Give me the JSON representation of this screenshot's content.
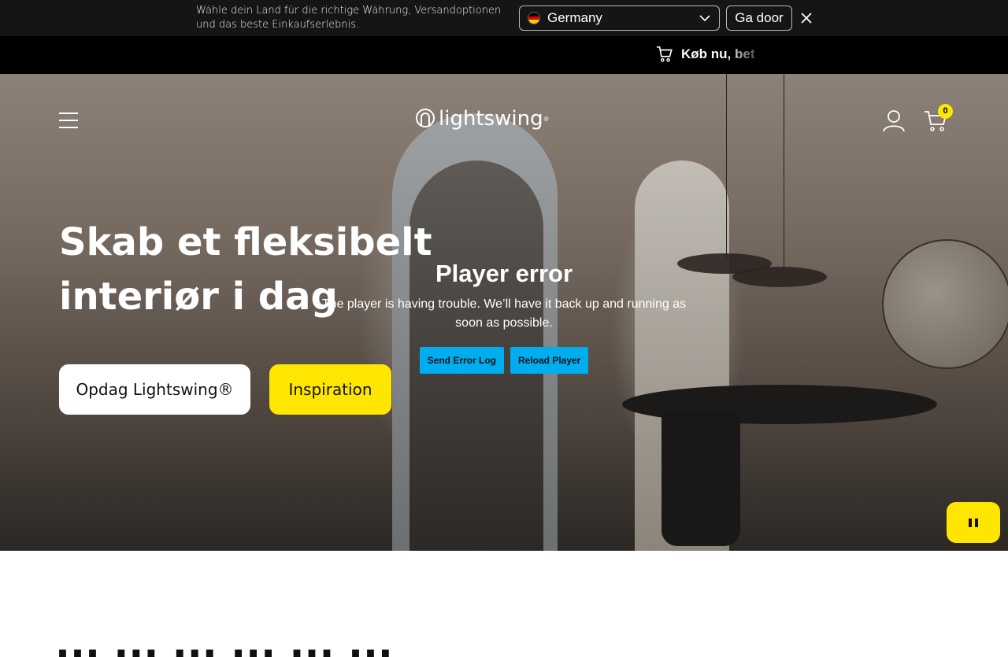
{
  "country_bar": {
    "message": "Wähle dein Land für die richtige Währung, Versandoptionen und das beste Einkaufserlebnis.",
    "selected_country": "Germany",
    "go_label": "Ga door",
    "icons": {
      "flag": "germany-flag-icon",
      "dropdown": "chevron-down-icon",
      "close": "close-icon"
    }
  },
  "announcement": {
    "text": "Køb nu, bet",
    "icon": "cart-icon"
  },
  "header": {
    "logo_text": "lightswing",
    "logo_mark": "®",
    "cart_count": "0",
    "icons": {
      "menu": "hamburger-menu-icon",
      "account": "user-icon",
      "cart": "cart-icon"
    }
  },
  "hero": {
    "headline": "Skab et fleksibelt interiør i dag",
    "primary_button": "Opdag Lightswing®",
    "secondary_button": "Inspiration",
    "pause_icon": "pause-icon"
  },
  "player_error": {
    "title": "Player error",
    "message": "The player is having trouble. We’ll have it back up and running as soon as possible.",
    "send_log_label": "Send Error Log",
    "reload_label": "Reload Player"
  },
  "next_section": {
    "heading_partial": "... ... ... ... ... ..."
  },
  "colors": {
    "accent_yellow": "#ffe600",
    "error_button_blue": "#00adef",
    "country_bar_bg": "#151515",
    "announcement_bg": "#000000"
  }
}
